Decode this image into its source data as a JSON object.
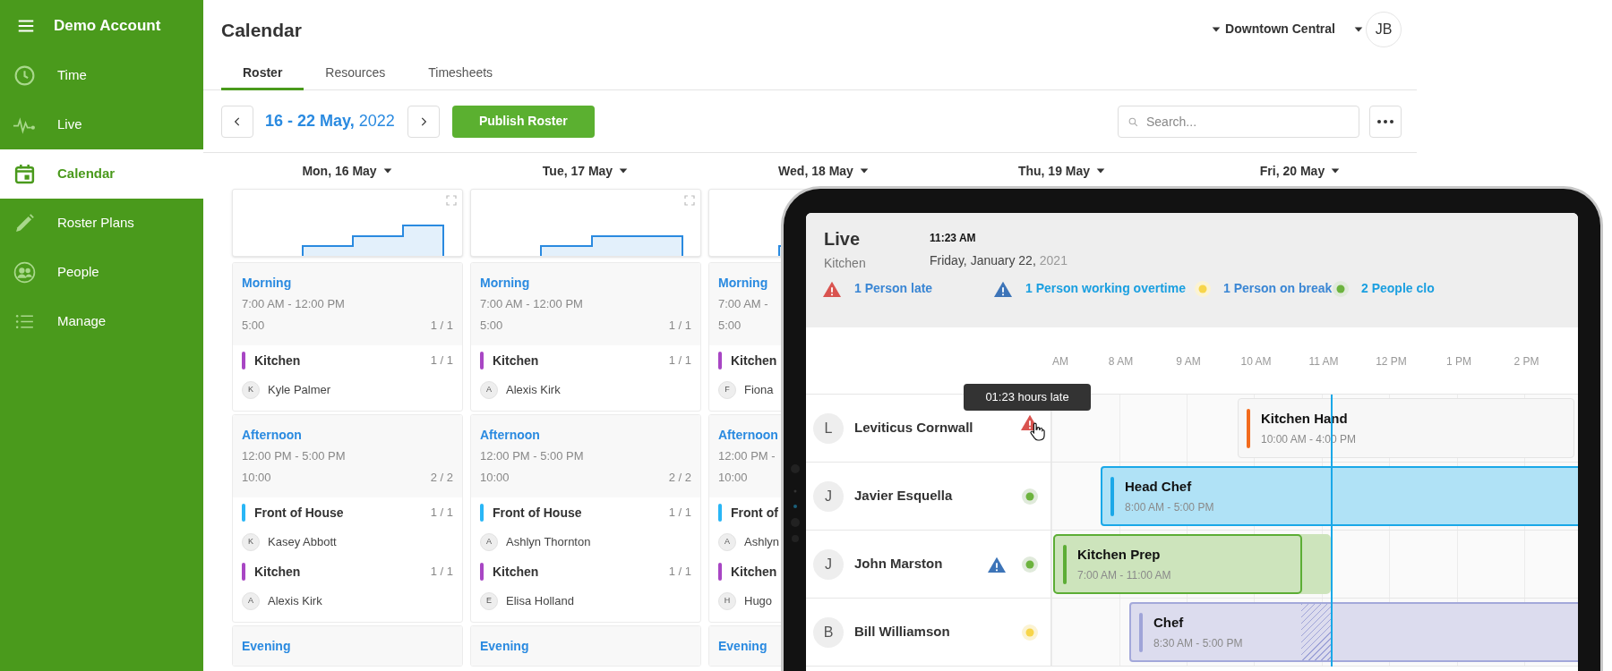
{
  "sidebar": {
    "account": "Demo Account",
    "items": [
      {
        "label": "Time",
        "selected": false
      },
      {
        "label": "Live",
        "selected": false
      },
      {
        "label": "Calendar",
        "selected": true
      },
      {
        "label": "Roster Plans",
        "selected": false
      },
      {
        "label": "People",
        "selected": false
      },
      {
        "label": "Manage",
        "selected": false
      }
    ]
  },
  "header": {
    "title": "Calendar",
    "location": "Downtown Central",
    "avatar": "JB"
  },
  "tabs": [
    {
      "label": "Roster",
      "selected": true
    },
    {
      "label": "Resources",
      "selected": false
    },
    {
      "label": "Timesheets",
      "selected": false
    }
  ],
  "toolbar": {
    "date_range": "**16 - 22 May,** 2022",
    "publish_button": "Publish Roster",
    "search_placeholder": "Search..."
  },
  "days": [
    {
      "label": "Mon, 16 May",
      "shifts": [
        {
          "name": "Morning",
          "time": "7:00 AM - 12:00 PM",
          "hours": "5:00",
          "filled": "1 / 1",
          "roles": [
            {
              "name": "Kitchen",
              "color": "#a846c4",
              "count": "1 / 1",
              "staff": [
                {
                  "initial": "K",
                  "name": "Kyle Palmer"
                }
              ]
            }
          ]
        },
        {
          "name": "Afternoon",
          "time": "12:00 PM - 5:00 PM",
          "hours": "10:00",
          "filled": "2 / 2",
          "roles": [
            {
              "name": "Front of House",
              "color": "#29b6f6",
              "count": "1 / 1",
              "staff": [
                {
                  "initial": "K",
                  "name": "Kasey Abbott"
                }
              ]
            },
            {
              "name": "Kitchen",
              "color": "#a846c4",
              "count": "1 / 1",
              "staff": [
                {
                  "initial": "A",
                  "name": "Alexis Kirk"
                }
              ]
            }
          ]
        },
        {
          "name": "Evening"
        }
      ]
    },
    {
      "label": "Tue, 17 May",
      "shifts": [
        {
          "name": "Morning",
          "time": "7:00 AM - 12:00 PM",
          "hours": "5:00",
          "filled": "1 / 1",
          "roles": [
            {
              "name": "Kitchen",
              "color": "#a846c4",
              "count": "1 / 1",
              "staff": [
                {
                  "initial": "A",
                  "name": "Alexis Kirk"
                }
              ]
            }
          ]
        },
        {
          "name": "Afternoon",
          "time": "12:00 PM - 5:00 PM",
          "hours": "10:00",
          "filled": "2 / 2",
          "roles": [
            {
              "name": "Front of House",
              "color": "#29b6f6",
              "count": "1 / 1",
              "staff": [
                {
                  "initial": "A",
                  "name": "Ashlyn Thornton"
                }
              ]
            },
            {
              "name": "Kitchen",
              "color": "#a846c4",
              "count": "1 / 1",
              "staff": [
                {
                  "initial": "E",
                  "name": "Elisa Holland"
                }
              ]
            }
          ]
        },
        {
          "name": "Evening"
        }
      ]
    },
    {
      "label": "Wed, 18 May",
      "shifts": [
        {
          "name": "Morning",
          "time": "7:00 AM -",
          "hours": "5:00",
          "roles": [
            {
              "name": "Kitchen",
              "color": "#a846c4",
              "staff": [
                {
                  "initial": "F",
                  "name": "Fiona"
                }
              ]
            }
          ]
        },
        {
          "name": "Afternoon",
          "time": "12:00 PM -",
          "hours": "10:00",
          "roles": [
            {
              "name": "Front of",
              "color": "#29b6f6",
              "staff": [
                {
                  "initial": "A",
                  "name": "Ashlyn"
                }
              ]
            },
            {
              "name": "Kitchen",
              "color": "#a846c4",
              "staff": [
                {
                  "initial": "H",
                  "name": "Hugo"
                }
              ]
            }
          ]
        },
        {
          "name": "Evening"
        }
      ]
    },
    {
      "label": "Thu, 19 May"
    },
    {
      "label": "Fri, 20 May"
    }
  ],
  "live": {
    "title": "Live",
    "subtitle": "Kitchen",
    "time": "11:23 AM",
    "date": "Friday, January 22,",
    "year": "2021",
    "alerts": [
      {
        "kind": "late",
        "label": "1 Person late"
      },
      {
        "kind": "overtime",
        "label": "1 Person working overtime"
      },
      {
        "kind": "break",
        "label": "1 Person on break"
      },
      {
        "kind": "clocked",
        "label": "2 People clo"
      }
    ],
    "hours": [
      "AM",
      "8 AM",
      "9 AM",
      "10 AM",
      "11 AM",
      "12 PM",
      "1 PM",
      "2 PM"
    ],
    "tooltip": "01:23 hours late",
    "staff": [
      {
        "initial": "L",
        "name": "Leviticus Cornwall",
        "indicators": [
          {
            "kind": "late"
          }
        ],
        "shift": {
          "kind": "upcoming",
          "title": "Kitchen Hand",
          "time": "10:00 AM - 4:00 PM",
          "color": "#f26b1d"
        }
      },
      {
        "initial": "J",
        "name": "Javier Esquella",
        "indicators": [
          {
            "kind": "clocked"
          }
        ],
        "shift": {
          "kind": "active",
          "title": "Head Chef",
          "time": "8:00 AM - 5:00 PM",
          "color": "#1aa8e8"
        }
      },
      {
        "initial": "J",
        "name": "John Marston",
        "indicators": [
          {
            "kind": "overtime"
          },
          {
            "kind": "clocked"
          }
        ],
        "shift": {
          "kind": "done",
          "title": "Kitchen Prep",
          "time": "7:00 AM - 11:00 AM",
          "color": "#5cad35"
        }
      },
      {
        "initial": "B",
        "name": "Bill Williamson",
        "indicators": [
          {
            "kind": "break"
          }
        ],
        "shift": {
          "kind": "break",
          "title": "Chef",
          "time": "8:30 AM - 5:00 PM",
          "color": "#9fa4d8"
        }
      }
    ]
  }
}
